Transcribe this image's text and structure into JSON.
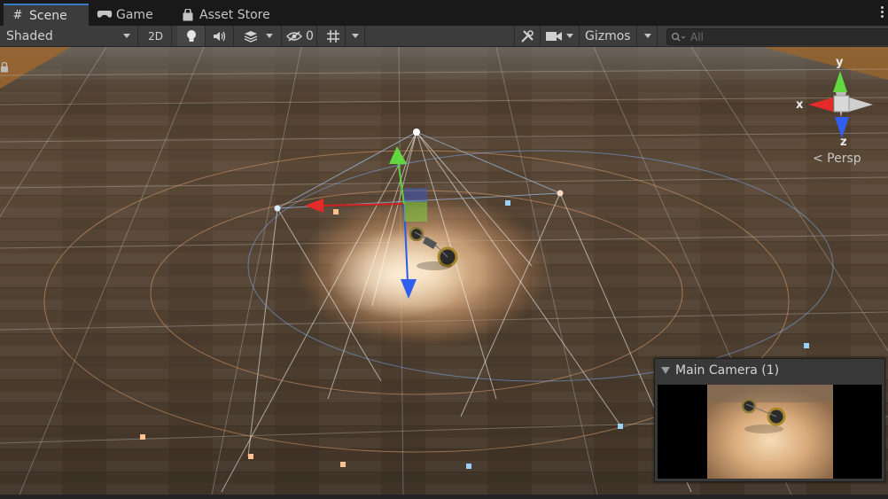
{
  "tabs": [
    {
      "label": "Scene",
      "icon": "hash-icon"
    },
    {
      "label": "Game",
      "icon": "gamepad-icon"
    },
    {
      "label": "Asset Store",
      "icon": "shopping-bag-icon"
    }
  ],
  "toolbar": {
    "shading_mode": "Shaded",
    "mode_2d_label": "2D",
    "hidden_count": "0",
    "gizmos_label": "Gizmos",
    "search_placeholder": "All"
  },
  "scene_gizmo": {
    "x_label": "x",
    "y_label": "y",
    "z_label": "z",
    "projection_label": "< Persp"
  },
  "camera_preview": {
    "title": "Main Camera (1)"
  },
  "colors": {
    "accent": "#3a79bb",
    "axis_x": "#e02a2a",
    "axis_y": "#5bd33a",
    "axis_z": "#2a5ae8",
    "toolbar_bg": "#3c3c3c"
  }
}
